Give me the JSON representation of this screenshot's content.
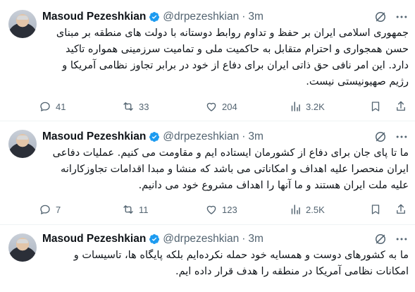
{
  "tweets": [
    {
      "author": "Masoud Pezeshkian",
      "handle": "@drpezeshkian",
      "separator": "·",
      "time": "3m",
      "text": "جمهوری اسلامی ایران بر حفظ و تداوم روابط دوستانه با دولت های منطقه بر مبنای حسن همجواری و احترام متقابل به حاکمیت ملی و تمامیت سرزمینی همواره تاکید دارد. این امر نافی حق ذاتی ایران برای دفاع از خود در برابر تجاوز نظامی آمریکا و رژیم صهیونیستی نیست.",
      "replies": "41",
      "reposts": "33",
      "likes": "204",
      "views": "3.2K"
    },
    {
      "author": "Masoud Pezeshkian",
      "handle": "@drpezeshkian",
      "separator": "·",
      "time": "3m",
      "text": "ما تا پای جان برای دفاع از کشورمان ایستاده ایم و مقاومت می کنیم. عملیات دفاعی ایران منحصرا علیه اهداف و امکاناتی می باشد که منشا و مبدا اقدامات تجاوزکارانه علیه ملت ایران هستند و ما آنها را اهداف مشروع خود می دانیم.",
      "replies": "7",
      "reposts": "11",
      "likes": "123",
      "views": "2.5K"
    },
    {
      "author": "Masoud Pezeshkian",
      "handle": "@drpezeshkian",
      "separator": "·",
      "time": "3m",
      "text": "ما به کشورهای دوست و همسایه خود حمله نکرده‌ایم بلکه پایگاه ها، تاسیسات و امکانات نظامی آمریکا در منطقه را هدف قرار داده ایم."
    }
  ],
  "colors": {
    "verified": "#1d9bf0",
    "muted": "#536471",
    "text": "#0f1419",
    "divider": "#eff3f4"
  },
  "icons": [
    "verified-badge-icon",
    "grok-icon",
    "more-icon",
    "reply-icon",
    "repost-icon",
    "like-icon",
    "views-icon",
    "bookmark-icon",
    "share-icon"
  ]
}
